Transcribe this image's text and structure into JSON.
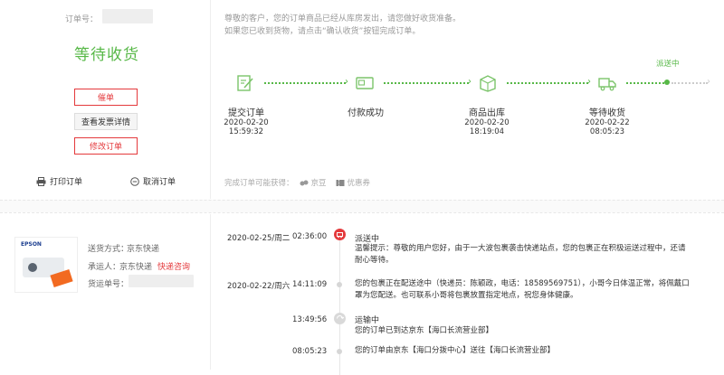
{
  "order": {
    "number_label": "订单号：",
    "status": "等待收货",
    "buttons": {
      "remind": "催单",
      "invoice": "查看发票详情",
      "modify": "修改订单"
    },
    "print": "打印订单",
    "cancel": "取消订单"
  },
  "notice": {
    "line1": "尊敬的客户，您的订单商品已经从库房发出，请您做好收货准备。",
    "line2": "如果您已收到货物，请点击“确认收货”按钮完成订单。"
  },
  "progress": {
    "current_label": "派送中",
    "steps": [
      {
        "title": "提交订单",
        "date": "2020-02-20",
        "time": "15:59:32",
        "icon": "edit-icon"
      },
      {
        "title": "付款成功",
        "date": "",
        "time": "",
        "icon": "card-icon"
      },
      {
        "title": "商品出库",
        "date": "2020-02-20",
        "time": "18:19:04",
        "icon": "box-icon"
      },
      {
        "title": "等待收货",
        "date": "2020-02-22",
        "time": "08:05:23",
        "icon": "truck-icon"
      }
    ],
    "rewards_label": "完成订单可能获得：",
    "rewards": [
      {
        "label": "京豆",
        "icon": "bean-icon"
      },
      {
        "label": "优惠券",
        "icon": "coupon-icon"
      }
    ]
  },
  "shipping": {
    "product_brand": "EPSON",
    "method_label": "送货方式：",
    "method_value": "京东快递",
    "carrier_label": "承运人：",
    "carrier_value": "京东快递",
    "consult_link": "快递咨询",
    "tracking_label": "货运单号："
  },
  "tracking": [
    {
      "date": "2020-02-25/周二",
      "time": "02:36:00",
      "status": "派送中",
      "lines": [
        "温馨提示：尊敬的用户您好，由于一大波包裹袭击快递站点，您的包裹正在积极运送过程中，还请",
        "耐心等待。"
      ]
    },
    {
      "date": "2020-02-22/周六",
      "time": "14:11:09",
      "status": "",
      "lines": [
        "您的包裹正在配送途中（快递员：陈颖政，电话：18589569751），小哥今日体温正常，将佩戴口",
        "罩为您配送。也可联系小哥将包裹放置指定地点，祝您身体健康。"
      ]
    },
    {
      "date": "",
      "time": "13:49:56",
      "status": "运输中",
      "lines": [
        "您的订单已到达京东【海口长流营业部】"
      ]
    },
    {
      "date": "",
      "time": "08:05:23",
      "status": "",
      "lines": [
        "您的订单由京东【海口分拨中心】送往【海口长流营业部】"
      ]
    }
  ]
}
